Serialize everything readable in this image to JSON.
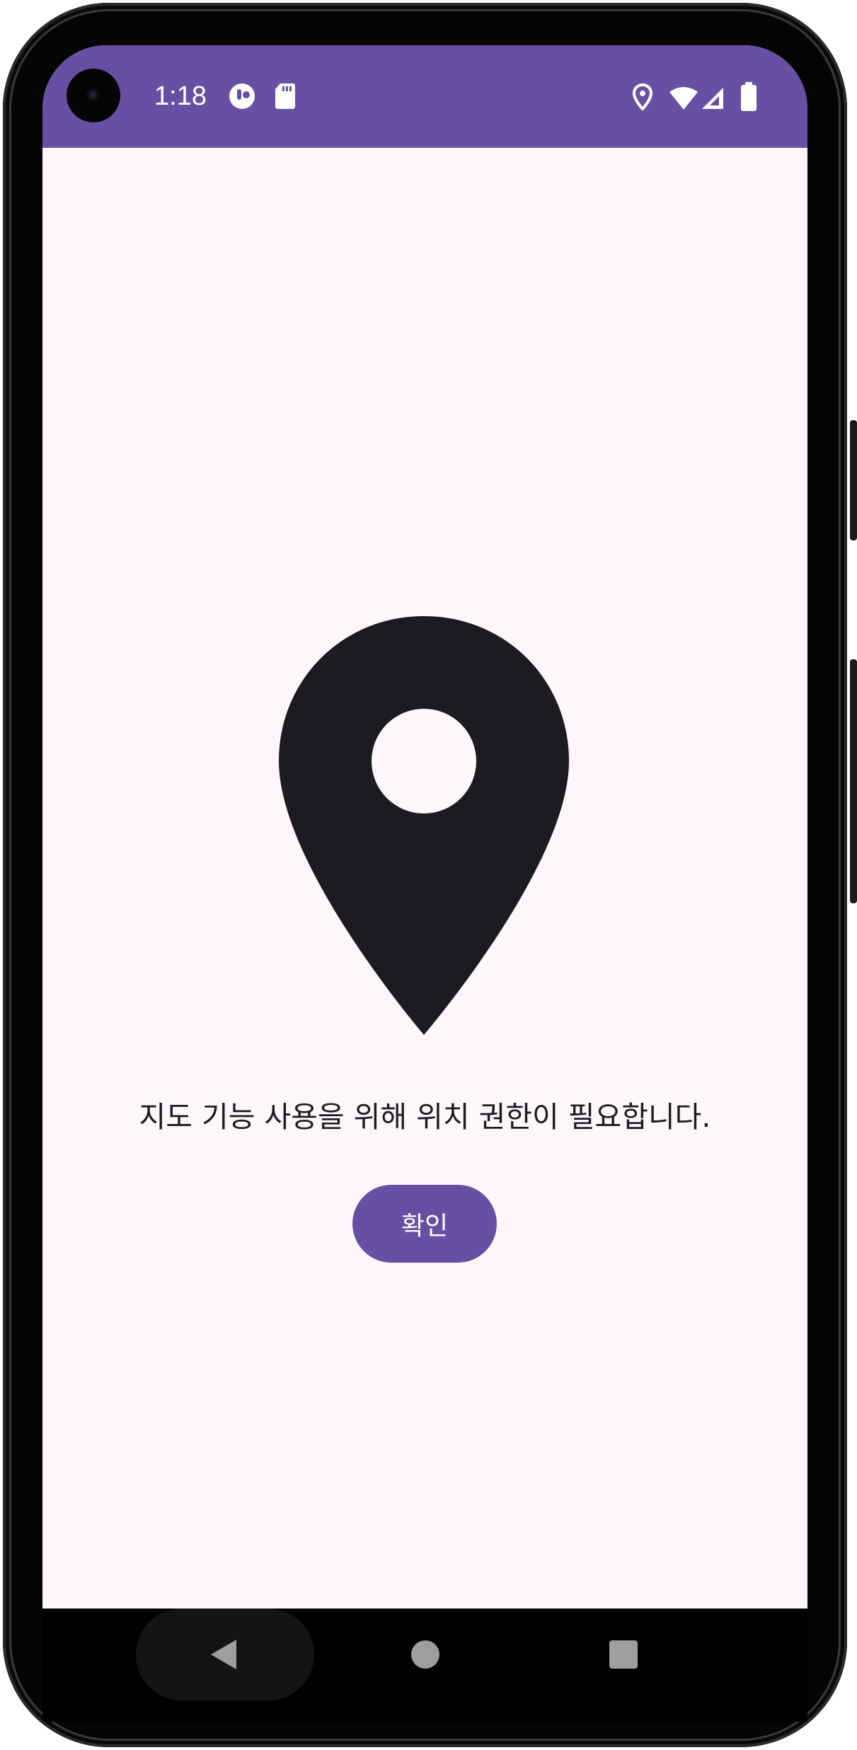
{
  "status_bar": {
    "time": "1:18",
    "background_color": "#6750a4",
    "left_icons": [
      "notification-app-icon",
      "sd-card-icon"
    ],
    "right_icons": [
      "location-icon",
      "wifi-icon",
      "signal-icon",
      "battery-icon"
    ]
  },
  "main": {
    "illustration_icon": "location-pin-icon",
    "message": "지도 기능 사용을 위해 위치 권한이 필요합니다.",
    "confirm_button_label": "확인",
    "accent_color": "#6750a4",
    "background_color": "#fdf7fb",
    "text_color": "#1c1b1f"
  },
  "nav_bar": {
    "buttons": [
      "back-icon",
      "home-icon",
      "recents-icon"
    ]
  }
}
